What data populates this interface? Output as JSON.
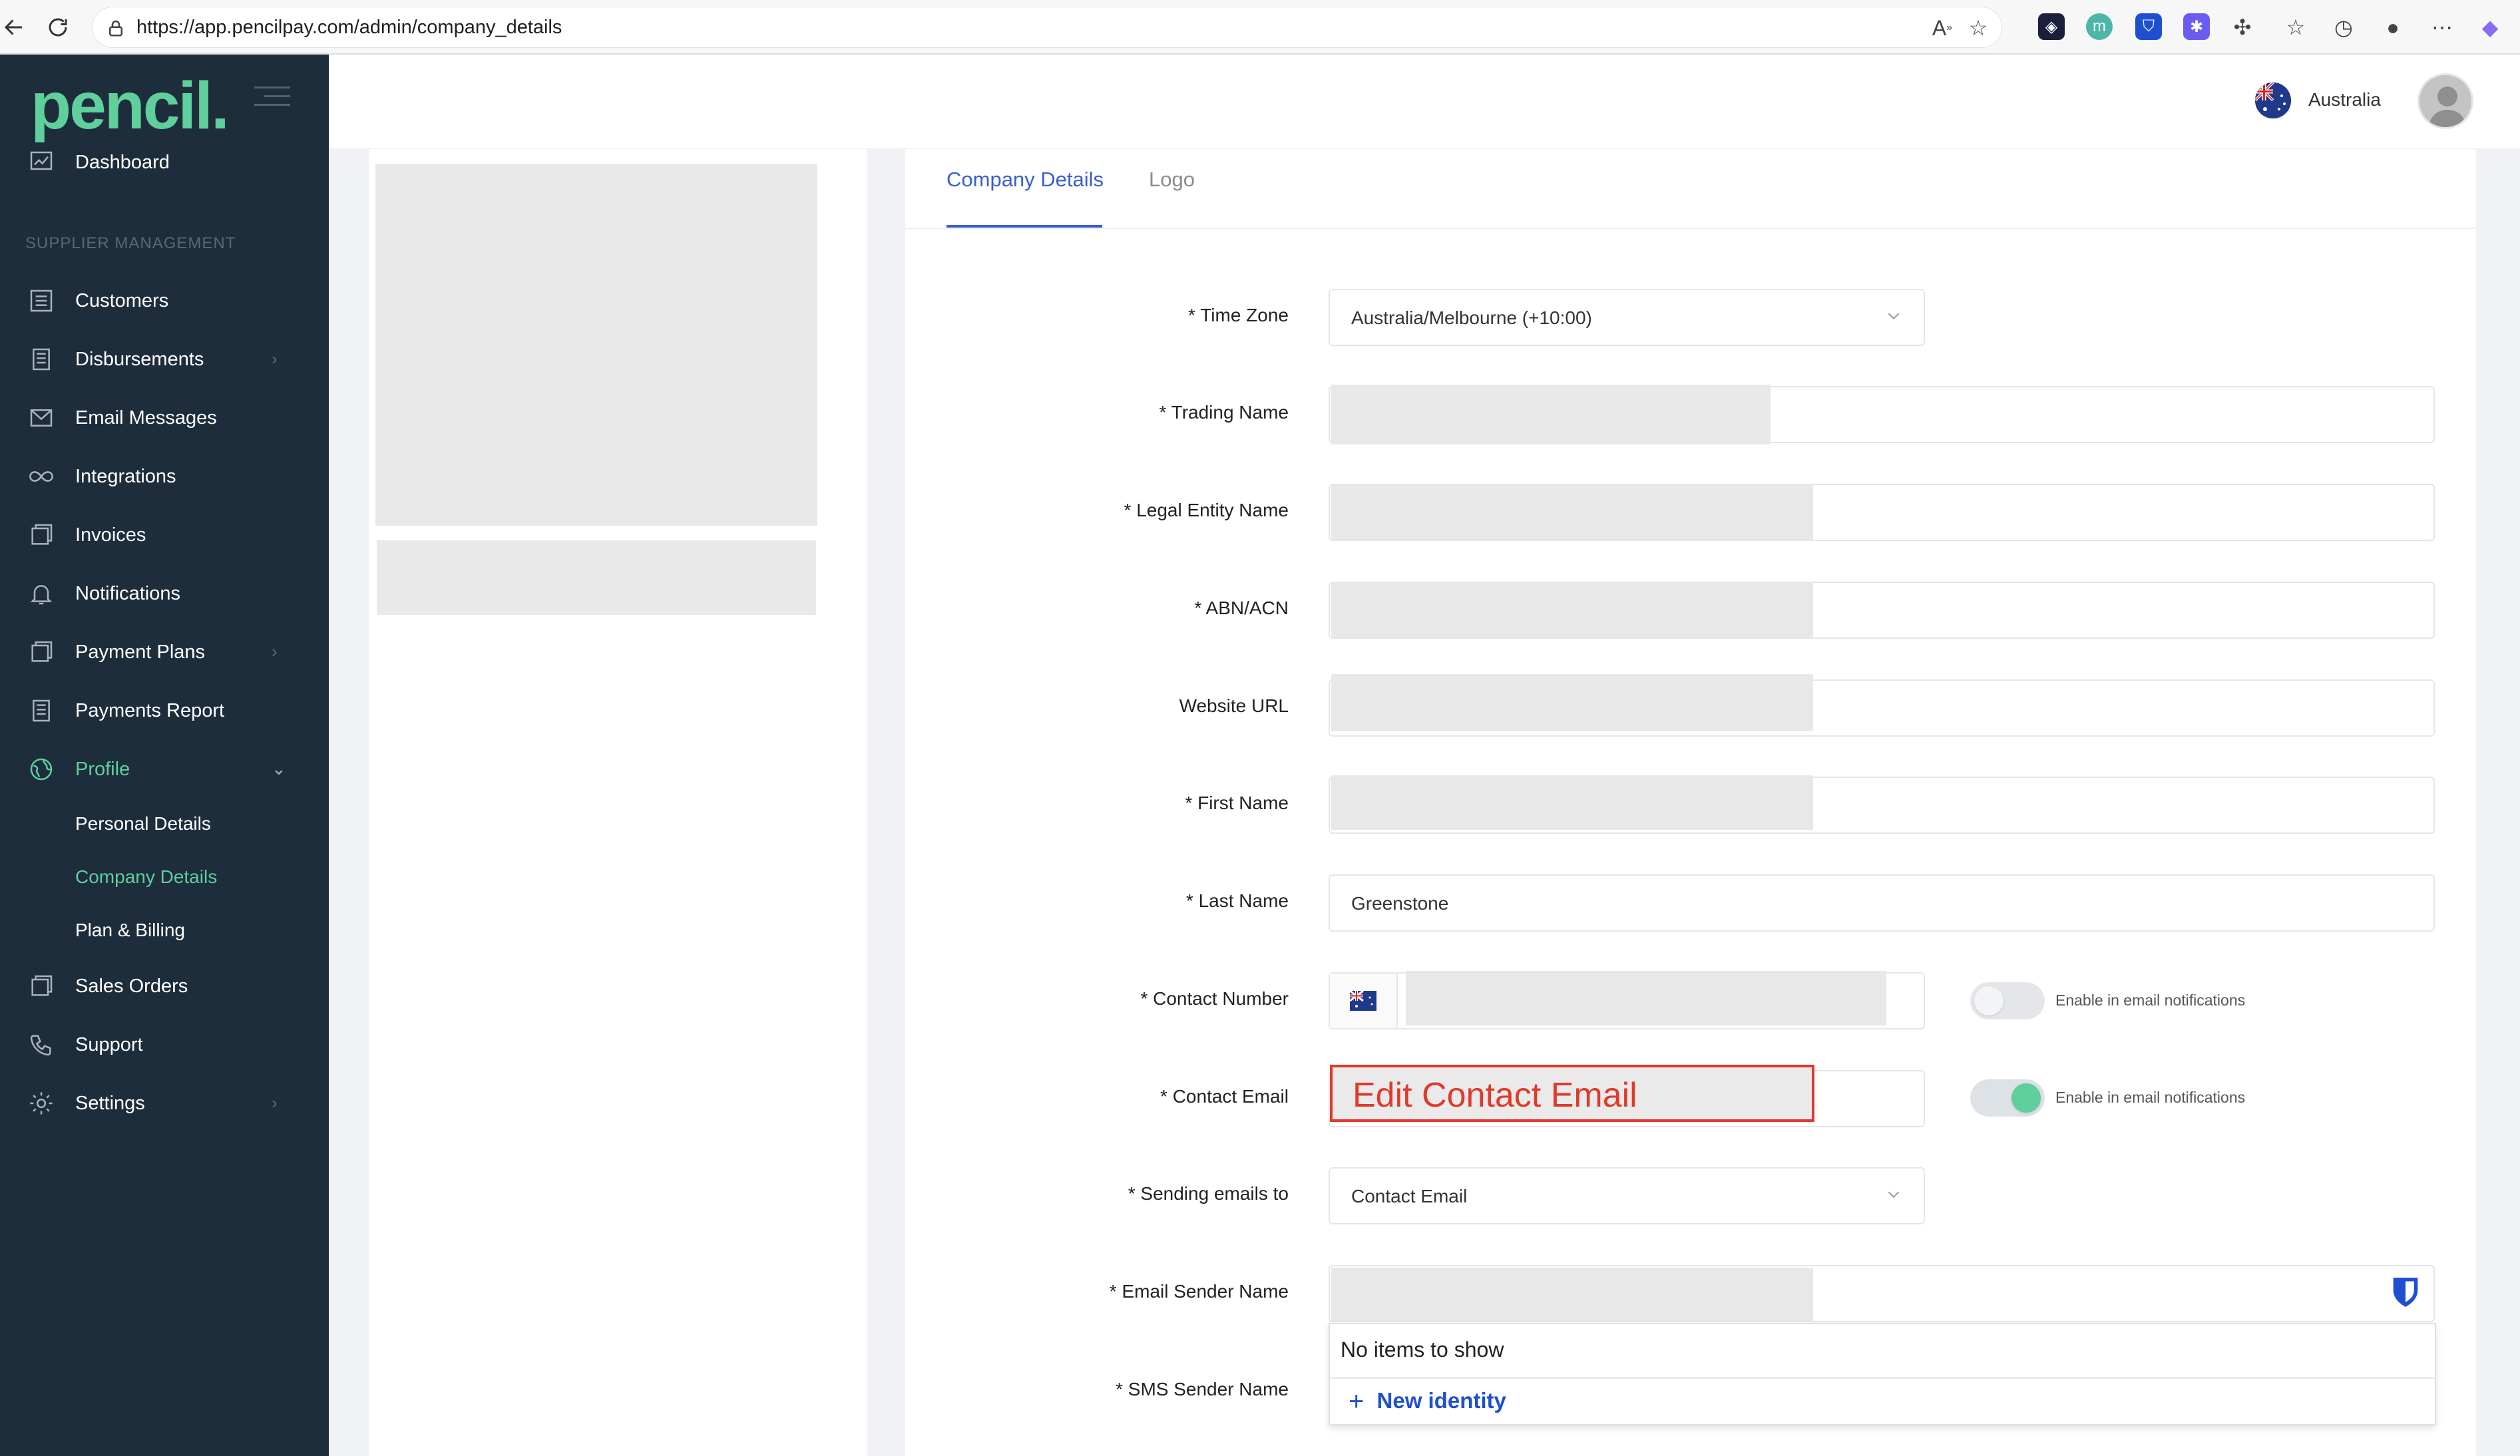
{
  "browser": {
    "url": "https://app.pencilpay.com/admin/company_details"
  },
  "sidebar": {
    "logo": "pencil.",
    "section_title": "SUPPLIER MANAGEMENT",
    "items": [
      {
        "label": "Dashboard"
      },
      {
        "label": "Customers"
      },
      {
        "label": "Disbursements"
      },
      {
        "label": "Email Messages"
      },
      {
        "label": "Integrations"
      },
      {
        "label": "Invoices"
      },
      {
        "label": "Notifications"
      },
      {
        "label": "Payment Plans"
      },
      {
        "label": "Payments Report"
      },
      {
        "label": "Profile"
      },
      {
        "label": "Sales Orders"
      },
      {
        "label": "Support"
      },
      {
        "label": "Settings"
      }
    ],
    "profile_sub": [
      {
        "label": "Personal Details"
      },
      {
        "label": "Company Details"
      },
      {
        "label": "Plan & Billing"
      }
    ]
  },
  "header": {
    "country": "Australia"
  },
  "tabs": [
    {
      "label": "Company Details"
    },
    {
      "label": "Logo"
    }
  ],
  "form": {
    "time_zone": {
      "label": "* Time Zone",
      "value": "Australia/Melbourne (+10:00)"
    },
    "trading_name": {
      "label": "* Trading Name"
    },
    "legal_entity_name": {
      "label": "* Legal Entity Name"
    },
    "abn_acn": {
      "label": "* ABN/ACN"
    },
    "website_url": {
      "label": "Website URL"
    },
    "first_name": {
      "label": "* First Name"
    },
    "last_name": {
      "label": "* Last Name",
      "value": "Greenstone"
    },
    "contact_number": {
      "label": "* Contact Number",
      "toggle_label": "Enable in email notifications",
      "toggle_on": false
    },
    "contact_email": {
      "label": "* Contact Email",
      "toggle_label": "Enable in email notifications",
      "toggle_on": true
    },
    "sending_emails_to": {
      "label": "* Sending emails to",
      "value": "Contact Email"
    },
    "email_sender_name": {
      "label": "* Email Sender Name"
    },
    "sms_sender_name": {
      "label": "* SMS Sender Name"
    }
  },
  "annotation": {
    "text": "Edit Contact Email"
  },
  "autofill_dropdown": {
    "empty_text": "No items to show",
    "new_identity": "New identity"
  },
  "colors": {
    "sidebar_bg": "#1e2d3c",
    "accent_green": "#5fcf9c",
    "tab_blue": "#3a5ed1",
    "annotation_red": "#e03a2b"
  }
}
